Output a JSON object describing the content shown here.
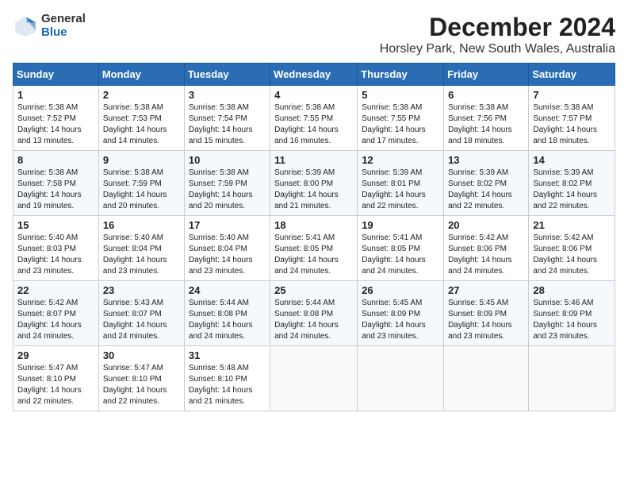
{
  "header": {
    "logo_general": "General",
    "logo_blue": "Blue",
    "month_title": "December 2024",
    "location": "Horsley Park, New South Wales, Australia"
  },
  "weekdays": [
    "Sunday",
    "Monday",
    "Tuesday",
    "Wednesday",
    "Thursday",
    "Friday",
    "Saturday"
  ],
  "weeks": [
    [
      {
        "day": "1",
        "sunrise": "5:38 AM",
        "sunset": "7:52 PM",
        "daylight": "14 hours and 13 minutes."
      },
      {
        "day": "2",
        "sunrise": "5:38 AM",
        "sunset": "7:53 PM",
        "daylight": "14 hours and 14 minutes."
      },
      {
        "day": "3",
        "sunrise": "5:38 AM",
        "sunset": "7:54 PM",
        "daylight": "14 hours and 15 minutes."
      },
      {
        "day": "4",
        "sunrise": "5:38 AM",
        "sunset": "7:55 PM",
        "daylight": "14 hours and 16 minutes."
      },
      {
        "day": "5",
        "sunrise": "5:38 AM",
        "sunset": "7:55 PM",
        "daylight": "14 hours and 17 minutes."
      },
      {
        "day": "6",
        "sunrise": "5:38 AM",
        "sunset": "7:56 PM",
        "daylight": "14 hours and 18 minutes."
      },
      {
        "day": "7",
        "sunrise": "5:38 AM",
        "sunset": "7:57 PM",
        "daylight": "14 hours and 18 minutes."
      }
    ],
    [
      {
        "day": "8",
        "sunrise": "5:38 AM",
        "sunset": "7:58 PM",
        "daylight": "14 hours and 19 minutes."
      },
      {
        "day": "9",
        "sunrise": "5:38 AM",
        "sunset": "7:59 PM",
        "daylight": "14 hours and 20 minutes."
      },
      {
        "day": "10",
        "sunrise": "5:38 AM",
        "sunset": "7:59 PM",
        "daylight": "14 hours and 20 minutes."
      },
      {
        "day": "11",
        "sunrise": "5:39 AM",
        "sunset": "8:00 PM",
        "daylight": "14 hours and 21 minutes."
      },
      {
        "day": "12",
        "sunrise": "5:39 AM",
        "sunset": "8:01 PM",
        "daylight": "14 hours and 22 minutes."
      },
      {
        "day": "13",
        "sunrise": "5:39 AM",
        "sunset": "8:02 PM",
        "daylight": "14 hours and 22 minutes."
      },
      {
        "day": "14",
        "sunrise": "5:39 AM",
        "sunset": "8:02 PM",
        "daylight": "14 hours and 22 minutes."
      }
    ],
    [
      {
        "day": "15",
        "sunrise": "5:40 AM",
        "sunset": "8:03 PM",
        "daylight": "14 hours and 23 minutes."
      },
      {
        "day": "16",
        "sunrise": "5:40 AM",
        "sunset": "8:04 PM",
        "daylight": "14 hours and 23 minutes."
      },
      {
        "day": "17",
        "sunrise": "5:40 AM",
        "sunset": "8:04 PM",
        "daylight": "14 hours and 23 minutes."
      },
      {
        "day": "18",
        "sunrise": "5:41 AM",
        "sunset": "8:05 PM",
        "daylight": "14 hours and 24 minutes."
      },
      {
        "day": "19",
        "sunrise": "5:41 AM",
        "sunset": "8:05 PM",
        "daylight": "14 hours and 24 minutes."
      },
      {
        "day": "20",
        "sunrise": "5:42 AM",
        "sunset": "8:06 PM",
        "daylight": "14 hours and 24 minutes."
      },
      {
        "day": "21",
        "sunrise": "5:42 AM",
        "sunset": "8:06 PM",
        "daylight": "14 hours and 24 minutes."
      }
    ],
    [
      {
        "day": "22",
        "sunrise": "5:42 AM",
        "sunset": "8:07 PM",
        "daylight": "14 hours and 24 minutes."
      },
      {
        "day": "23",
        "sunrise": "5:43 AM",
        "sunset": "8:07 PM",
        "daylight": "14 hours and 24 minutes."
      },
      {
        "day": "24",
        "sunrise": "5:44 AM",
        "sunset": "8:08 PM",
        "daylight": "14 hours and 24 minutes."
      },
      {
        "day": "25",
        "sunrise": "5:44 AM",
        "sunset": "8:08 PM",
        "daylight": "14 hours and 24 minutes."
      },
      {
        "day": "26",
        "sunrise": "5:45 AM",
        "sunset": "8:09 PM",
        "daylight": "14 hours and 23 minutes."
      },
      {
        "day": "27",
        "sunrise": "5:45 AM",
        "sunset": "8:09 PM",
        "daylight": "14 hours and 23 minutes."
      },
      {
        "day": "28",
        "sunrise": "5:46 AM",
        "sunset": "8:09 PM",
        "daylight": "14 hours and 23 minutes."
      }
    ],
    [
      {
        "day": "29",
        "sunrise": "5:47 AM",
        "sunset": "8:10 PM",
        "daylight": "14 hours and 22 minutes."
      },
      {
        "day": "30",
        "sunrise": "5:47 AM",
        "sunset": "8:10 PM",
        "daylight": "14 hours and 22 minutes."
      },
      {
        "day": "31",
        "sunrise": "5:48 AM",
        "sunset": "8:10 PM",
        "daylight": "14 hours and 21 minutes."
      },
      null,
      null,
      null,
      null
    ]
  ],
  "labels": {
    "sunrise_label": "Sunrise:",
    "sunset_label": "Sunset:",
    "daylight_label": "Daylight:"
  }
}
